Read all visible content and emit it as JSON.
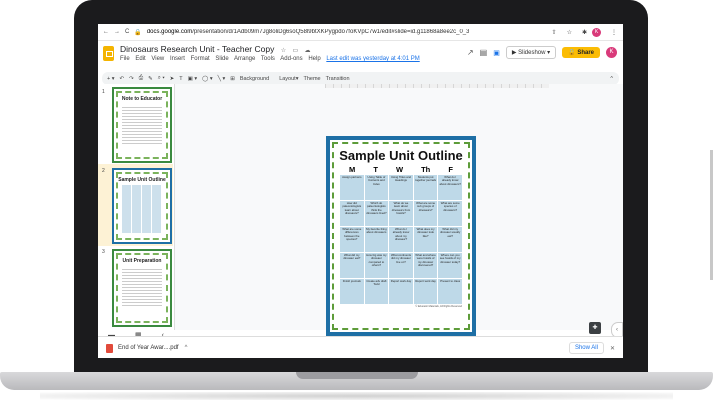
{
  "browser": {
    "url_domain": "docs.google.com",
    "url_path": "/presentation/d/1Adb09m7Jg8oliDg6soQ58l9btXKPygpdo7foKVpC7w1/edit#slide=id.g11868a8ee2c_0_3",
    "profile_initial": "K"
  },
  "doc": {
    "title": "Dinosaurs Research Unit - Teacher Copy",
    "menus": [
      "File",
      "Edit",
      "View",
      "Insert",
      "Format",
      "Slide",
      "Arrange",
      "Tools",
      "Add-ons",
      "Help"
    ],
    "last_edit": "Last edit was yesterday at 4:01 PM",
    "slideshow_label": "Slideshow",
    "share_label": "Share",
    "avatar_initial": "K"
  },
  "toolbar": {
    "background_label": "Background",
    "layout_label": "Layout",
    "theme_label": "Theme",
    "transition_label": "Transition"
  },
  "filmstrip": {
    "slides": [
      {
        "number": "1",
        "title": "Note to Educator"
      },
      {
        "number": "2",
        "title": "Sample Unit Outline"
      },
      {
        "number": "3",
        "title": "Unit Preparation"
      }
    ]
  },
  "slide": {
    "title": "Sample Unit Outline",
    "days": [
      "M",
      "T",
      "W",
      "Th",
      "F"
    ],
    "rows": [
      [
        "Assign partners",
        "Using Table of Contents and Index",
        "Using Titles and Headings",
        "Students put together journals",
        "What do I already know about dinosaurs?"
      ],
      [
        "How did paleontologists learn about dinosaurs?",
        "Which do paleontologists think the dinosaurs lived?",
        "What do we learn about dinosaurs from fossils?",
        "What are some sub groups of dinosaurs?",
        "What are some species of dinosaurs?"
      ],
      [
        "What are some differences between the species?",
        "My favorite thing about dinosaurs",
        "What do I already know about my dinosaur?",
        "What does my dinosaur look like?",
        "What did my dinosaur usually eat?"
      ],
      [
        "What did my dinosaur eat?",
        "How big was my dinosaur compared to others?",
        "What continents did my dinosaur live on?",
        "What and where were fossils of my dinosaur discovered?",
        "Where can you see fossils of my dinosaur today?"
      ],
      [
        "Finish journals",
        "Create adv draft Todd",
        "Report work day",
        "Report work day",
        "Present to class"
      ]
    ],
    "copyright": "© Educator Materials, All Rights Reserved"
  },
  "download": {
    "filename": "End of Year Awar....pdf",
    "show_all": "Show All"
  }
}
